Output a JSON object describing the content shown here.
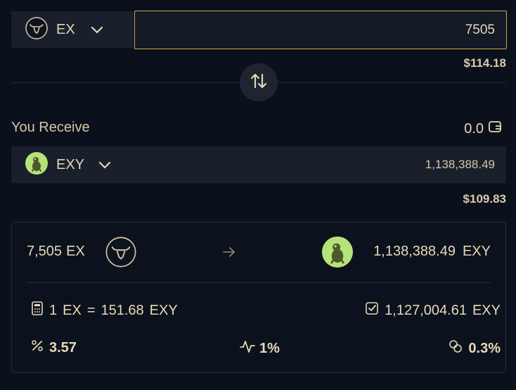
{
  "pay": {
    "token_symbol": "EX",
    "amount": "7505",
    "usd_value": "$114.18"
  },
  "receive": {
    "label": "You Receive",
    "balance": "0.0",
    "token_symbol": "EXY",
    "amount": "1,138,388.49",
    "usd_value": "$109.83"
  },
  "summary": {
    "from_amount": "7,505",
    "from_symbol": "EX",
    "to_amount": "1,138,388.49",
    "to_symbol": "EXY",
    "rate_base": "1",
    "rate_base_symbol": "EX",
    "rate_equals": "=",
    "rate_value": "151.68",
    "rate_quote_symbol": "EXY",
    "min_received": "1,127,004.61",
    "min_received_symbol": "EXY",
    "price_impact": "3.57",
    "slippage": "1%",
    "fee": "0.3%"
  },
  "colors": {
    "accent_border": "#c9a64c",
    "background": "#0b111c",
    "panel": "#1a202b",
    "text": "#e8d9b8",
    "exy_token_bg": "#b5e37a"
  },
  "icons": {
    "ex_token": "bull-head-icon",
    "exy_token": "frog-icon",
    "swap": "swap-vertical-arrows-icon",
    "wallet": "wallet-icon",
    "calculator": "calculator-icon",
    "check": "checkbox-check-icon",
    "percent": "percent-icon",
    "pulse": "pulse-icon",
    "coins": "coins-icon",
    "arrow": "arrow-right-icon"
  }
}
